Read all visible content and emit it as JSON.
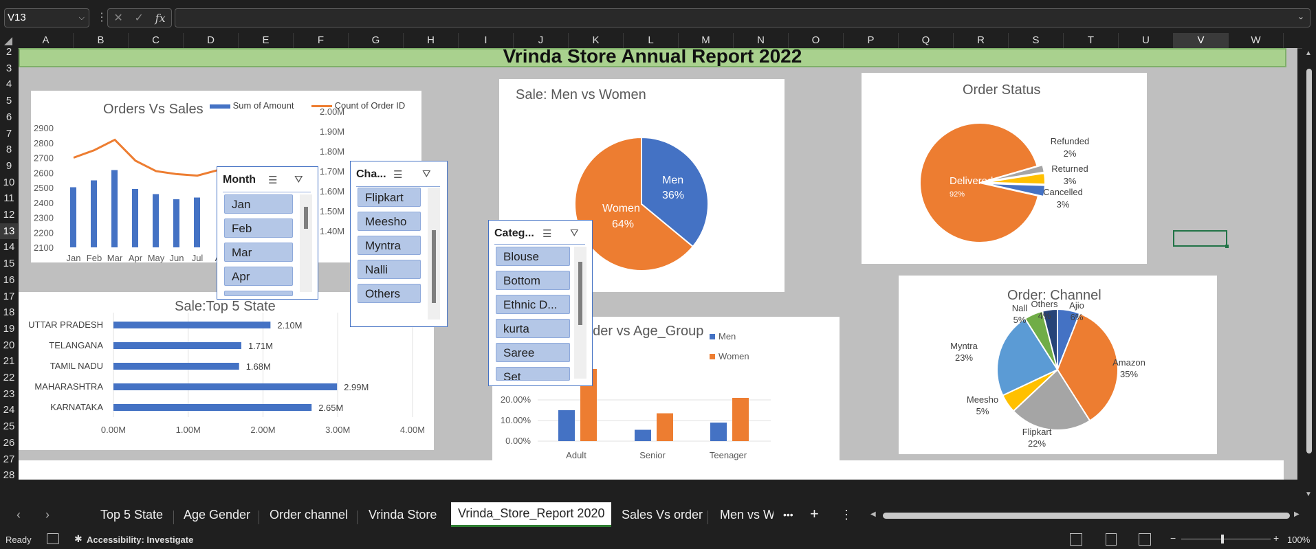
{
  "formula_bar": {
    "name_box": "V13",
    "cancel_icon": "✕",
    "enter_icon": "✓",
    "fx_label": "fx",
    "formula_value": ""
  },
  "columns": [
    "A",
    "B",
    "C",
    "D",
    "E",
    "F",
    "G",
    "H",
    "I",
    "J",
    "K",
    "L",
    "M",
    "N",
    "O",
    "P",
    "Q",
    "R",
    "S",
    "T",
    "U",
    "V",
    "W"
  ],
  "selected_column": "V",
  "rows": [
    "2",
    "3",
    "4",
    "5",
    "6",
    "7",
    "8",
    "9",
    "10",
    "11",
    "12",
    "13",
    "14",
    "15",
    "16",
    "17",
    "18",
    "19",
    "20",
    "21",
    "22",
    "23",
    "24",
    "25",
    "26",
    "27",
    "28"
  ],
  "selected_row": "13",
  "report_title": "Vrinda Store Annual Report 2022",
  "charts": {
    "orders_vs_sales": {
      "title": "Orders Vs Sales",
      "legend": [
        "Sum of Amount",
        "Count of Order ID"
      ],
      "y_left_ticks": [
        "2900",
        "2800",
        "2700",
        "2600",
        "2500",
        "2400",
        "2300",
        "2200",
        "2100"
      ],
      "y_right_ticks": [
        "2.00M",
        "1.90M",
        "1.80M",
        "1.70M",
        "1.60M",
        "1.50M",
        "1.40M"
      ],
      "x_ticks": [
        "Jan",
        "Feb",
        "Mar",
        "Apr",
        "May",
        "Jun",
        "Jul",
        "A"
      ]
    },
    "top5_state": {
      "title": "Sale:Top 5 State",
      "x_ticks": [
        "0.00M",
        "1.00M",
        "2.00M",
        "3.00M",
        "4.00M"
      ]
    },
    "men_vs_women": {
      "title": "Sale: Men vs Women"
    },
    "age_group": {
      "title": "nder vs Age_Group",
      "legend": [
        "Men",
        "Women"
      ],
      "y_ticks": [
        "20.00%",
        "10.00%",
        "0.00%"
      ]
    },
    "order_status": {
      "title": "Order Status"
    },
    "order_channel": {
      "title": "Order: Channel"
    }
  },
  "chart_data": [
    {
      "type": "bar",
      "title": "Orders Vs Sales",
      "categories": [
        "Jan",
        "Feb",
        "Mar",
        "Apr",
        "May",
        "Jun",
        "Jul"
      ],
      "series": [
        {
          "name": "Sum of Amount",
          "values": [
            1.75,
            1.79,
            1.85,
            1.74,
            1.71,
            1.68,
            1.69
          ],
          "axis": "right",
          "color": "#4472c4"
        },
        {
          "name": "Count of Order ID",
          "values": [
            2700,
            2750,
            2820,
            2680,
            2610,
            2590,
            2580
          ],
          "axis": "left",
          "color": "#ed7d31",
          "render": "line"
        }
      ],
      "ylim_left": [
        2100,
        2900
      ],
      "ylim_right": [
        1.4,
        2.0
      ]
    },
    {
      "type": "bar",
      "title": "Sale:Top 5 State",
      "orientation": "horizontal",
      "categories": [
        "UTTAR PRADESH",
        "TELANGANA",
        "TAMIL NADU",
        "MAHARASHTRA",
        "KARNATAKA"
      ],
      "values": [
        2.1,
        1.71,
        1.68,
        2.99,
        2.65
      ],
      "labels": [
        "2.10M",
        "1.71M",
        "1.68M",
        "2.99M",
        "2.65M"
      ],
      "xlim": [
        0,
        4
      ]
    },
    {
      "type": "pie",
      "title": "Sale: Men vs Women",
      "categories": [
        "Men",
        "Women"
      ],
      "values": [
        36,
        64
      ],
      "labels": [
        "36%",
        "64%"
      ],
      "colors": [
        "#4472c4",
        "#ed7d31"
      ]
    },
    {
      "type": "bar",
      "title": "nder vs Age_Group",
      "categories": [
        "Adult",
        "Senior",
        "Teenager"
      ],
      "series": [
        {
          "name": "Men",
          "values": [
            15.0,
            5.5,
            9.0
          ]
        },
        {
          "name": "Women",
          "values": [
            35.0,
            13.5,
            21.0
          ]
        }
      ],
      "colors": [
        "#4472c4",
        "#ed7d31"
      ]
    },
    {
      "type": "pie",
      "title": "Order Status",
      "categories": [
        "Delivered",
        "Refunded",
        "Returned",
        "Cancelled"
      ],
      "values": [
        92,
        2,
        3,
        3
      ],
      "labels": [
        "92%",
        "2%",
        "3%",
        "3%"
      ],
      "colors": [
        "#ed7d31",
        "#a5a5a5",
        "#ffc000",
        "#4472c4"
      ]
    },
    {
      "type": "pie",
      "title": "Order: Channel",
      "categories": [
        "Ajio",
        "Amazon",
        "Flipkart",
        "Meesho",
        "Myntra",
        "Nalli",
        "Others"
      ],
      "values": [
        6,
        35,
        22,
        5,
        23,
        5,
        4
      ],
      "labels": [
        "6%",
        "35%",
        "22%",
        "5%",
        "23%",
        "5%",
        "4%"
      ],
      "display_names": [
        "Ajio",
        "Amazon",
        "Flipkart",
        "Meesho",
        "Myntra",
        "Nall",
        "Others"
      ],
      "colors": [
        "#4472c4",
        "#ed7d31",
        "#a5a5a5",
        "#ffc000",
        "#5b9bd5",
        "#70ad47",
        "#264478"
      ]
    }
  ],
  "slicers": {
    "month": {
      "header": "Month",
      "items": [
        "Jan",
        "Feb",
        "Mar",
        "Apr"
      ]
    },
    "channel": {
      "header": "Cha...",
      "items": [
        "Flipkart",
        "Meesho",
        "Myntra",
        "Nalli",
        "Others"
      ]
    },
    "category": {
      "header": "Categ...",
      "items": [
        "Blouse",
        "Bottom",
        "Ethnic D...",
        "kurta",
        "Saree",
        "Set"
      ]
    }
  },
  "sheet_tabs": [
    "Top 5 State",
    "Age Gender",
    "Order channel",
    "Vrinda Store",
    "Vrinda_Store_Report 2020",
    "Sales Vs order",
    "Men vs Wo"
  ],
  "active_tab": "Vrinda_Store_Report 2020",
  "add_sheet": "+",
  "more_tabs": "•••",
  "status": {
    "ready": "Ready",
    "accessibility": "Accessibility: Investigate",
    "zoom": "100%"
  }
}
